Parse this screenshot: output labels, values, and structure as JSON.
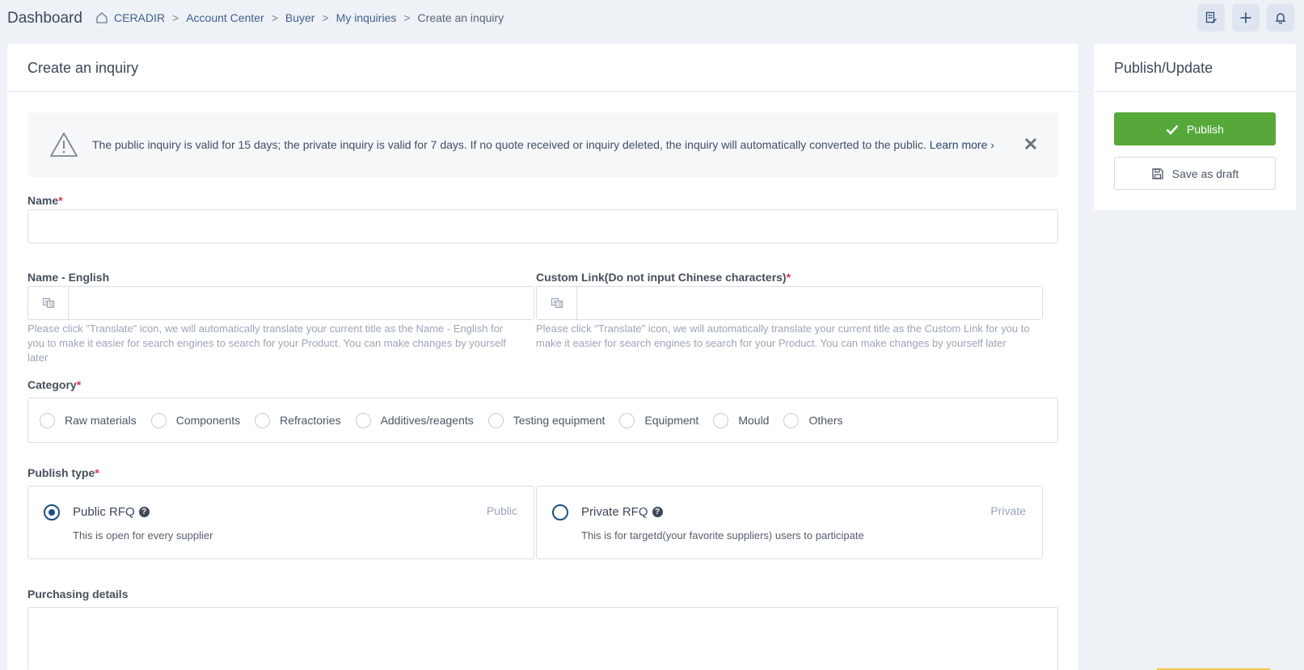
{
  "header": {
    "title": "Dashboard",
    "breadcrumb": [
      "CERADIR",
      "Account Center",
      "Buyer",
      "My inquiries",
      "Create an inquiry"
    ],
    "separator": ">"
  },
  "main": {
    "title": "Create an inquiry",
    "notice": {
      "text": "The public inquiry is valid for 15 days; the private inquiry is valid for 7 days. If no quote received or inquiry deleted, the inquiry will automatically converted to the public.",
      "link": "Learn more",
      "link_chevron": "›"
    },
    "name": {
      "label": "Name",
      "required": "*",
      "value": ""
    },
    "name_english": {
      "label": "Name - English",
      "value": "",
      "help": "Please click \"Translate\" icon, we will automatically translate your current title as the Name - English for you to make it easier for search engines to search for your Product. You can make changes by yourself later"
    },
    "custom_link": {
      "label": "Custom Link(Do not input Chinese characters)",
      "required": "*",
      "value": "",
      "help": "Please click \"Translate\" icon, we will automatically translate your current title as the Custom Link for you to make it easier for search engines to search for your Product. You can make changes by yourself later"
    },
    "category": {
      "label": "Category",
      "required": "*",
      "options": [
        "Raw materials",
        "Components",
        "Refractories",
        "Additives/reagents",
        "Testing equipment",
        "Equipment",
        "Mould",
        "Others"
      ]
    },
    "publish_type": {
      "label": "Publish type",
      "required": "*",
      "public": {
        "title": "Public RFQ",
        "tag": "Public",
        "desc": "This is open for every supplier",
        "selected": true
      },
      "private": {
        "title": "Private RFQ",
        "tag": "Private",
        "desc": "This is for targetd(your favorite suppliers) users to participate",
        "selected": false
      }
    },
    "purchasing_details": {
      "label": "Purchasing details",
      "value": ""
    }
  },
  "side": {
    "title": "Publish/Update",
    "publish_label": "Publish",
    "draft_label": "Save as draft"
  },
  "colors": {
    "publish_green": "#56a83a",
    "required_red": "#e2334d",
    "radio_blue": "#1f4e82"
  }
}
